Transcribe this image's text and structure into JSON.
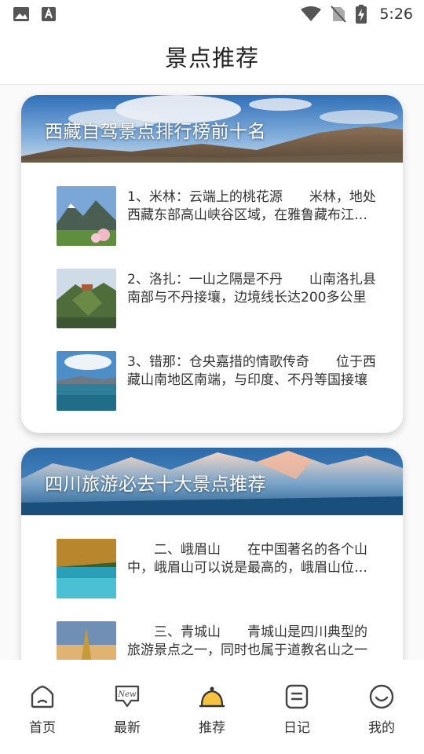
{
  "status_bar": {
    "time": "5:26",
    "icons": [
      "image-icon",
      "font-a-icon",
      "wifi-icon",
      "no-sim-icon",
      "battery-charging-icon"
    ]
  },
  "header": {
    "title": "景点推荐"
  },
  "cards": [
    {
      "title": "西藏自驾景点排行榜前十名",
      "items": [
        {
          "text": "1、米林：云端上的桃花源　　米林，地处西藏东部高山峡谷区域，在雅鲁藏布江中下游"
        },
        {
          "text": "2、洛扎：一山之隔是不丹　　山南洛扎县南部与不丹接壤，边境线长达200多公里"
        },
        {
          "text": "3、错那：仓央嘉措的情歌传奇　　位于西藏山南地区南端，与印度、不丹等国接壤"
        }
      ]
    },
    {
      "title": "四川旅游必去十大景点推荐",
      "items": [
        {
          "text": "　　二、峨眉山　　在中国著名的各个山中，峨眉山可以说是最高的，峨眉山位于四川"
        },
        {
          "text": "　　三、青城山　　青城山是四川典型的旅游景点之一，同时也属于道教名山之一"
        }
      ]
    }
  ],
  "bottom_nav": [
    {
      "label": "首页",
      "icon": "home-icon"
    },
    {
      "label": "最新",
      "icon": "new-badge-icon"
    },
    {
      "label": "推荐",
      "icon": "recommend-bell-icon"
    },
    {
      "label": "日记",
      "icon": "diary-icon"
    },
    {
      "label": "我的",
      "icon": "profile-smile-icon"
    }
  ],
  "colors": {
    "accent": "#f5c242",
    "text": "#333333",
    "icon_stroke": "#444444"
  }
}
